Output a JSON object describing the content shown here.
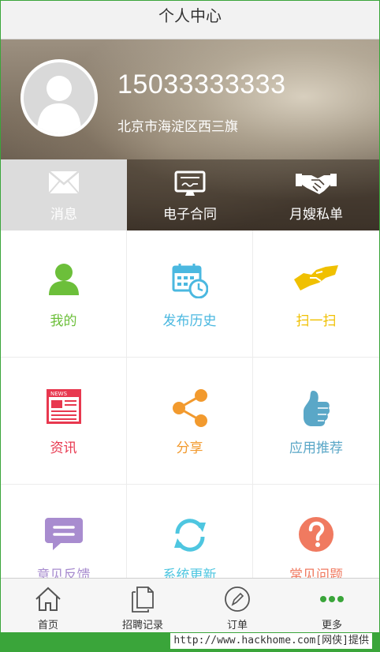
{
  "header": {
    "title": "个人中心"
  },
  "profile": {
    "phone": "15033333333",
    "address": "北京市海淀区西三旗"
  },
  "banner_tabs": [
    {
      "label": "消息",
      "icon": "envelope-icon"
    },
    {
      "label": "电子合同",
      "icon": "contract-screen-icon"
    },
    {
      "label": "月嫂私单",
      "icon": "handshake-icon"
    }
  ],
  "grid": [
    {
      "label": "我的",
      "icon": "person-icon",
      "color": "#6cbf3a"
    },
    {
      "label": "发布历史",
      "icon": "calendar-clock-icon",
      "color": "#4bb8e0"
    },
    {
      "label": "扫一扫",
      "icon": "handshake-scan-icon",
      "color": "#f0c000"
    },
    {
      "label": "资讯",
      "icon": "news-icon",
      "color": "#e8384f"
    },
    {
      "label": "分享",
      "icon": "share-icon",
      "color": "#f29a2e"
    },
    {
      "label": "应用推荐",
      "icon": "thumbs-up-icon",
      "color": "#5aa7c7"
    },
    {
      "label": "意见反馈",
      "icon": "chat-bubble-icon",
      "color": "#a88ccf"
    },
    {
      "label": "系统更新",
      "icon": "refresh-icon",
      "color": "#4ec6e0"
    },
    {
      "label": "常见问题",
      "icon": "question-icon",
      "color": "#f07a60"
    }
  ],
  "bottom_nav": [
    {
      "label": "首页",
      "icon": "home-icon"
    },
    {
      "label": "招聘记录",
      "icon": "documents-icon"
    },
    {
      "label": "订单",
      "icon": "pen-circle-icon"
    },
    {
      "label": "更多",
      "icon": "more-dots-icon",
      "color": "#3aa53a"
    }
  ],
  "footer": {
    "text": "http://www.hackhome.com[网侠]提供"
  }
}
